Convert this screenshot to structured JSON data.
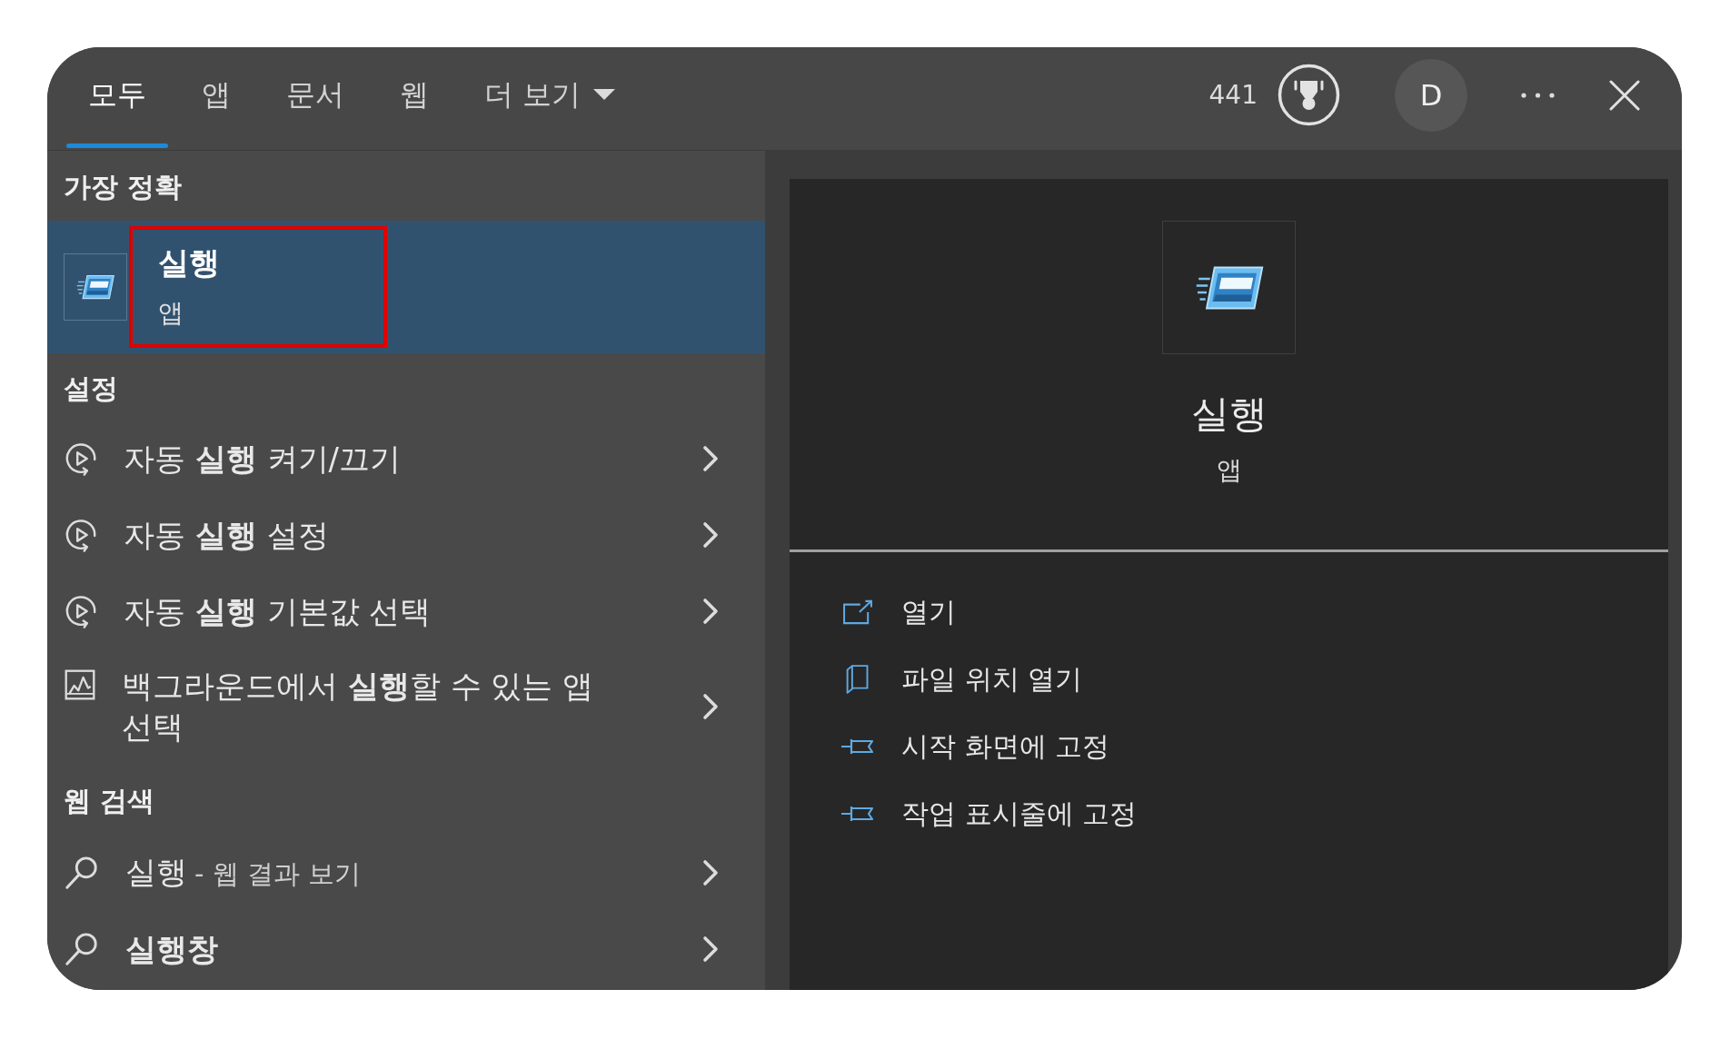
{
  "tabs": [
    {
      "label": "모두",
      "kind": "tab",
      "selected": true
    },
    {
      "label": "앱",
      "kind": "tab",
      "selected": false
    },
    {
      "label": "문서",
      "kind": "tab",
      "selected": false
    },
    {
      "label": "웹",
      "kind": "tab",
      "selected": false
    },
    {
      "label": "더 보기",
      "kind": "dropdown",
      "selected": false
    }
  ],
  "toolbar": {
    "points": "441",
    "avatar": "D"
  },
  "best_match": {
    "heading": "가장 정확",
    "title": "실행",
    "subtitle": "앱",
    "selected": true,
    "highlighted": true
  },
  "settings": {
    "heading": "설정",
    "items": [
      {
        "kind": "autoplay",
        "label": "자동 **실행** 켜기/끄기",
        "selected": false
      },
      {
        "kind": "autoplay",
        "label": "자동 **실행** 설정",
        "selected": false
      },
      {
        "kind": "autoplay",
        "label": "자동 **실행** 기본값 선택",
        "selected": false
      },
      {
        "kind": "background",
        "label": "백그라운드에서 **실행**할 수 있는 앱 선택",
        "selected": false
      }
    ]
  },
  "web_search": {
    "heading": "웹 검색",
    "items": [
      {
        "kind": "web_results",
        "label": "실행",
        "suffix": "- 웹 결과 보기",
        "selected": false
      },
      {
        "kind": "suggestion",
        "label": "실행창",
        "selected": false
      }
    ]
  },
  "preview": {
    "title": "실행",
    "subtitle": "앱",
    "actions": [
      {
        "kind": "open",
        "label": "열기"
      },
      {
        "kind": "file_location",
        "label": "파일 위치 열기"
      },
      {
        "kind": "pin",
        "label": "시작 화면에 고정"
      },
      {
        "kind": "pin",
        "label": "작업 표시줄에 고정"
      }
    ]
  }
}
